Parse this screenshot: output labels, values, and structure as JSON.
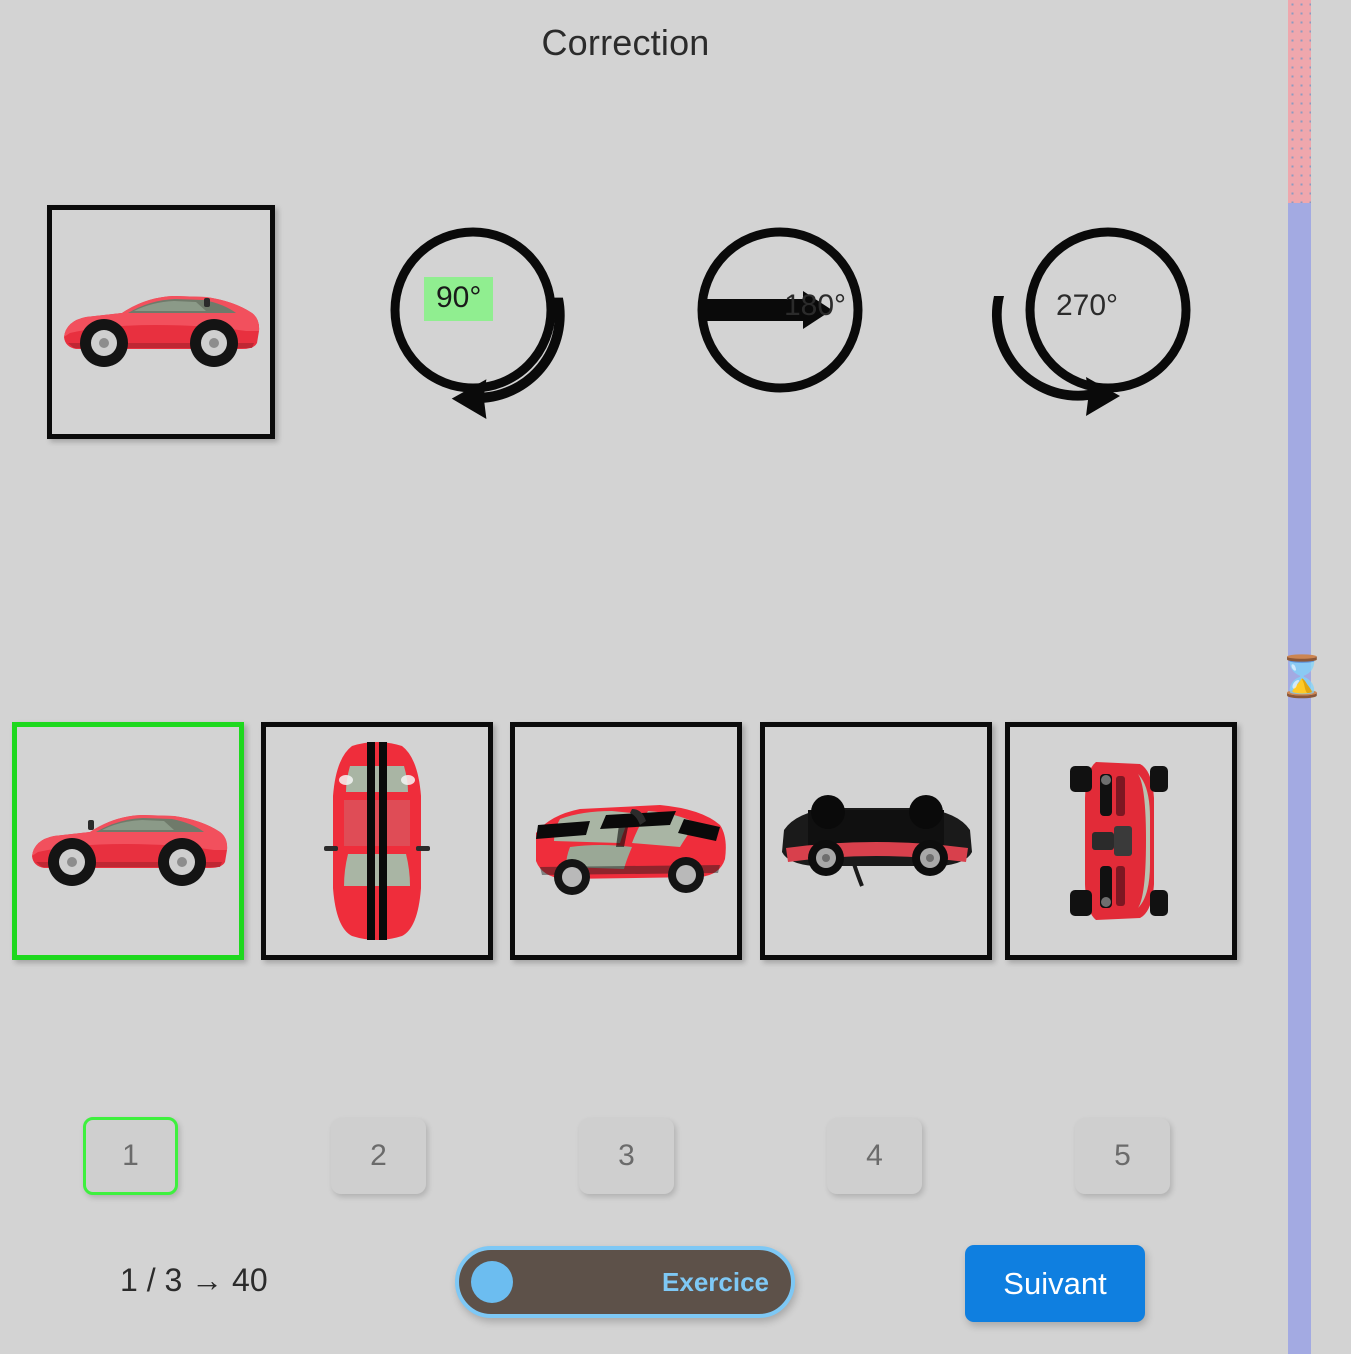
{
  "header": {
    "title": "Correction"
  },
  "prompt": {
    "reference_image": {
      "name": "reference-car-side-view",
      "alt": "red sports car side view facing left"
    },
    "rotations": [
      {
        "id": "rot-90",
        "label": "90°",
        "icon": "rotate-90-icon",
        "highlighted": true,
        "highlight_color": "#90ee90"
      },
      {
        "id": "rot-180",
        "label": "180°",
        "icon": "rotate-180-icon",
        "highlighted": false,
        "highlight_color": ""
      },
      {
        "id": "rot-270",
        "label": "270°",
        "icon": "rotate-270-icon",
        "highlighted": false,
        "highlight_color": ""
      }
    ]
  },
  "options": [
    {
      "index": 1,
      "name": "option-car-side-view",
      "alt": "red sports car side view facing left",
      "selected": true,
      "border_color": "#1ed81e"
    },
    {
      "index": 2,
      "name": "option-car-top-view",
      "alt": "red sports car top view with black stripes",
      "selected": false,
      "border_color": "#0b0b0b"
    },
    {
      "index": 3,
      "name": "option-car-three-quarter",
      "alt": "red sports car angled top three-quarter view",
      "selected": false,
      "border_color": "#0b0b0b"
    },
    {
      "index": 4,
      "name": "option-car-underside",
      "alt": "red sports car underside view, mostly black",
      "selected": false,
      "border_color": "#0b0b0b"
    },
    {
      "index": 5,
      "name": "option-car-rear-rotated",
      "alt": "red sports car rear view rotated vertically",
      "selected": false,
      "border_color": "#0b0b0b"
    }
  ],
  "numpad": [
    {
      "label": "1",
      "active": true
    },
    {
      "label": "2",
      "active": false
    },
    {
      "label": "3",
      "active": false
    },
    {
      "label": "4",
      "active": false
    },
    {
      "label": "5",
      "active": false
    }
  ],
  "footer": {
    "counter": "1 / 3 → 40",
    "toggle": {
      "label": "Exercice",
      "state": "off",
      "track_color": "#5d5149",
      "accent_color": "#7ec8f5"
    },
    "next_button": {
      "label": "Suivant",
      "color": "#0f7fe0"
    }
  },
  "progress": {
    "top_segment_color": "#efa7ad",
    "bottom_segment_color": "#a3aae2",
    "marker_icon": "hourglass-icon",
    "marker_glyph": "⌛"
  }
}
